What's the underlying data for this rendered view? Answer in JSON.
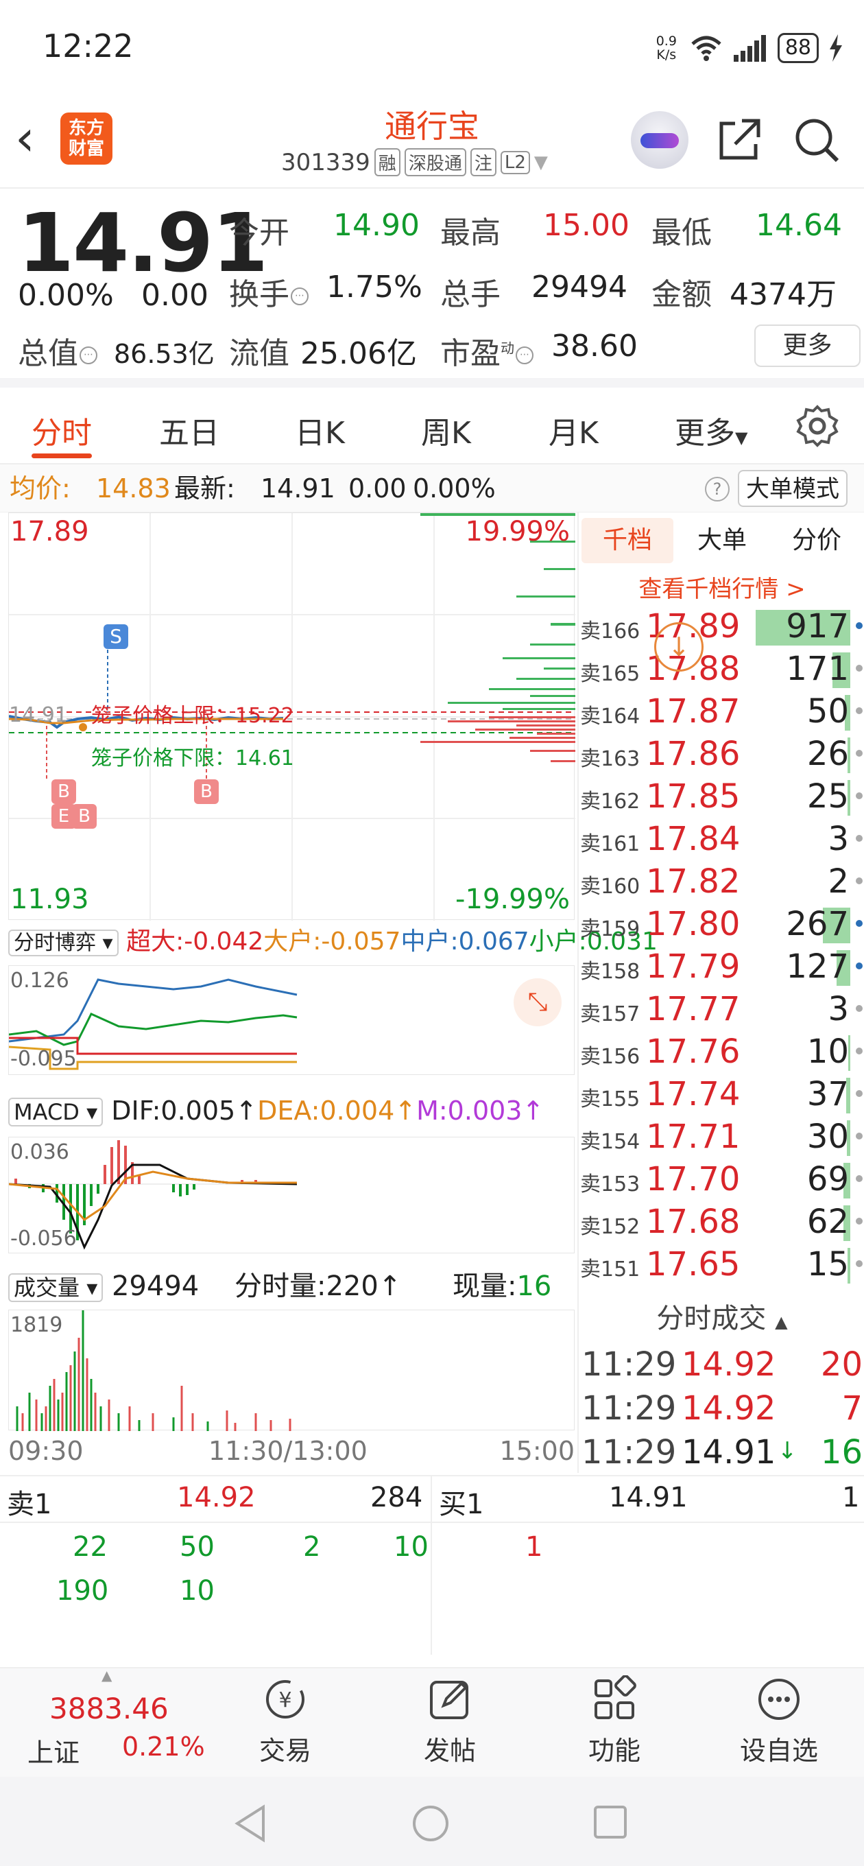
{
  "status": {
    "time": "12:22",
    "speed_top": "0.9",
    "speed_unit": "K/s",
    "battery": "88"
  },
  "header": {
    "logo_line1": "东方",
    "logo_line2": "财富",
    "name": "通行宝",
    "code": "301339",
    "tags": [
      "融",
      "深股通",
      "注",
      "L2"
    ]
  },
  "quote": {
    "price": "14.91",
    "change_pct": "0.00%",
    "change": "0.00",
    "open_label": "今开",
    "open": "14.90",
    "high_label": "最高",
    "high": "15.00",
    "low_label": "最低",
    "low": "14.64",
    "turnover_label": "换手",
    "turnover": "1.75%",
    "volume_label": "总手",
    "volume": "29494",
    "amount_label": "金额",
    "amount": "4374万",
    "mktcap_label": "总值",
    "mktcap": "86.53亿",
    "float_label": "流值",
    "float": "25.06亿",
    "pe_label": "市盈",
    "pe_sup": "动",
    "pe": "38.60",
    "more": "更多"
  },
  "tabs": [
    "分时",
    "五日",
    "日K",
    "周K",
    "月K",
    "更多"
  ],
  "avg": {
    "avg_label": "均价:",
    "avg": "14.83",
    "latest_label": "最新:",
    "latest": "14.91",
    "chg": "0.00",
    "pct": "0.00%",
    "mode_button": "大单模式"
  },
  "price_chart": {
    "top_price": "17.89",
    "top_pct": "19.99%",
    "bottom_price": "11.93",
    "bottom_pct": "-19.99%",
    "left_mark": "14.91",
    "upper_limit_label": "笼子价格上限：15.22",
    "lower_limit_label": "笼子价格下限：14.61",
    "markers": [
      "S",
      "B",
      "B",
      "E",
      "B"
    ]
  },
  "game": {
    "select": "分时博弈",
    "l1": "超大:",
    "v1": "-0.042",
    "l2": "大户:",
    "v2": "-0.057",
    "l3": "中户:",
    "v3": "0.067",
    "l4": "小户:",
    "v4": "0.031",
    "top": "0.126",
    "bottom": "-0.095"
  },
  "macd": {
    "select": "MACD",
    "dif": "DIF:0.005↑",
    "dea": "DEA:0.004↑",
    "m": "M:0.003↑",
    "top": "0.036",
    "bottom": "-0.056"
  },
  "vol": {
    "select": "成交量",
    "total": "29494",
    "fs_label": "分时量:220↑",
    "now_label": "现量:",
    "now": "16",
    "top": "1819"
  },
  "time_axis": {
    "start": "09:30",
    "mid": "11:30/13:00",
    "end": "15:00"
  },
  "book": {
    "tabs": [
      "千档",
      "大单",
      "分价"
    ],
    "link": "查看千档行情 >",
    "rows": [
      {
        "l": "卖166",
        "p": "17.89",
        "v": "917"
      },
      {
        "l": "卖165",
        "p": "17.88",
        "v": "171"
      },
      {
        "l": "卖164",
        "p": "17.87",
        "v": "50"
      },
      {
        "l": "卖163",
        "p": "17.86",
        "v": "26"
      },
      {
        "l": "卖162",
        "p": "17.85",
        "v": "25"
      },
      {
        "l": "卖161",
        "p": "17.84",
        "v": "3"
      },
      {
        "l": "卖160",
        "p": "17.82",
        "v": "2"
      },
      {
        "l": "卖159",
        "p": "17.80",
        "v": "267"
      },
      {
        "l": "卖158",
        "p": "17.79",
        "v": "127"
      },
      {
        "l": "卖157",
        "p": "17.77",
        "v": "3"
      },
      {
        "l": "卖156",
        "p": "17.76",
        "v": "10"
      },
      {
        "l": "卖155",
        "p": "17.74",
        "v": "37"
      },
      {
        "l": "卖154",
        "p": "17.71",
        "v": "30"
      },
      {
        "l": "卖153",
        "p": "17.70",
        "v": "69"
      },
      {
        "l": "卖152",
        "p": "17.68",
        "v": "62"
      },
      {
        "l": "卖151",
        "p": "17.65",
        "v": "15"
      }
    ],
    "ticks_title": "分时成交",
    "ticks": [
      {
        "t": "11:29",
        "p": "14.92",
        "v": "20"
      },
      {
        "t": "11:29",
        "p": "14.92",
        "v": "7"
      },
      {
        "t": "11:29",
        "p": "14.91",
        "v": "16"
      }
    ]
  },
  "sellbuy": {
    "sell_label": "卖1",
    "sell_price": "14.92",
    "sell_vol": "284",
    "buy_label": "买1",
    "buy_price": "14.91",
    "buy_vol": "1",
    "sell_queue": [
      "22",
      "50",
      "2",
      "10",
      "190",
      "10"
    ],
    "buy_queue": [
      "1"
    ]
  },
  "nav": {
    "index_value": "3883.46",
    "index_name": "上证",
    "index_pct": "0.21%",
    "items": [
      "交易",
      "发帖",
      "功能",
      "设自选"
    ]
  }
}
